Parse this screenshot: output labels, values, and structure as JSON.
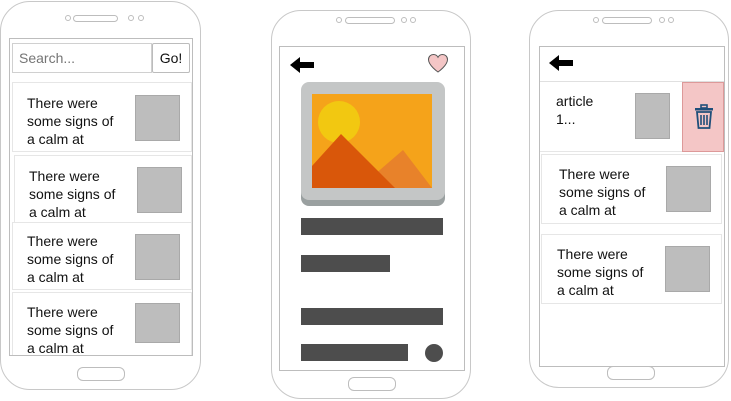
{
  "phone1": {
    "search": {
      "placeholder": "Search...",
      "button": "Go!"
    },
    "items": [
      {
        "text": "There were\nsome signs of\na calm at"
      },
      {
        "text": "There were\nsome signs of\na calm at"
      },
      {
        "text": "There were\nsome signs of\na calm at"
      },
      {
        "text": "There were\nsome signs of\na calm at"
      }
    ]
  },
  "phone2": {
    "icons": {
      "back": "arrow-left-icon",
      "favorite": "heart-icon",
      "image": "image-placeholder-icon"
    },
    "colors": {
      "heart": "#f4c6c6",
      "sky": "#f5a31a",
      "sun": "#f2c811",
      "mountain_front": "#d9570a",
      "mountain_back": "#e8822a"
    }
  },
  "phone3": {
    "items": [
      {
        "text": "article\n1..."
      },
      {
        "text": "There were\nsome signs of\na calm at"
      },
      {
        "text": "There were\nsome signs of\na calm at"
      }
    ],
    "icons": {
      "back": "arrow-left-icon",
      "delete": "trash-icon"
    },
    "colors": {
      "delete_bg": "#f4c6c6",
      "trash": "#1f4f7a"
    }
  }
}
